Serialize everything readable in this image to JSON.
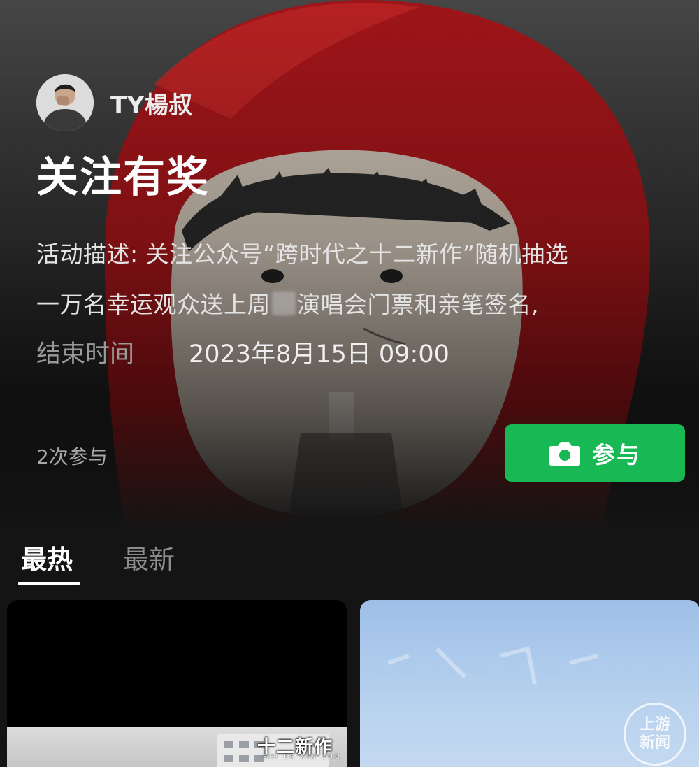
{
  "author": {
    "name": "TY楊叔"
  },
  "activity": {
    "title": "关注有奖",
    "description_line1": "活动描述: 关注公众号“跨时代之十二新作”随机抽选",
    "description_line2_a": "一万名幸运观众送上周",
    "description_line2_b": "演唱会门票和亲笔签名,",
    "end_time_label": "结束时间",
    "end_time_value": "2023年8月15日 09:00",
    "participants": "2次参与",
    "join_label": "参与"
  },
  "tabs": [
    {
      "label": "最热",
      "active": true
    },
    {
      "label": "最新",
      "active": false
    }
  ],
  "cards": {
    "left_brand": "十二新作",
    "left_brand_sub": "SHI ER XIN ZUO"
  },
  "watermark": {
    "line1": "上游",
    "line2": "新闻"
  },
  "colors": {
    "accent": "#18b954",
    "background": "#141414",
    "hood_red": "#b5181c"
  },
  "icons": {
    "join": "camera-icon"
  }
}
